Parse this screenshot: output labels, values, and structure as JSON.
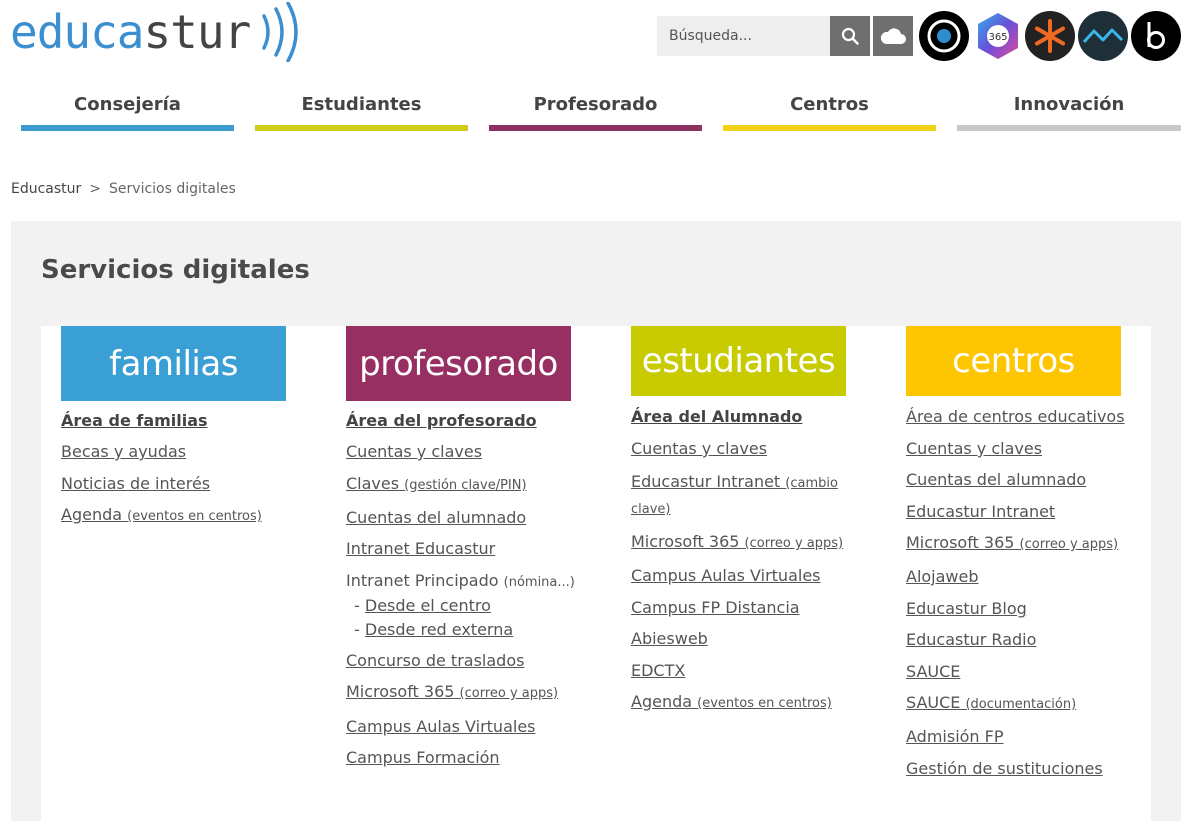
{
  "header": {
    "logo": {
      "part1": "educa",
      "part2": "stur"
    },
    "search": {
      "placeholder": "Búsqueda..."
    },
    "colors": {
      "logo_blue": "#3b8fd0",
      "button_gray": "#6f6f6f"
    }
  },
  "nav": [
    {
      "label": "Consejería",
      "color": "#3b9ccd"
    },
    {
      "label": "Estudiantes",
      "color": "#cfcd1a"
    },
    {
      "label": "Profesorado",
      "color": "#8e3160"
    },
    {
      "label": "Centros",
      "color": "#f2d218"
    },
    {
      "label": "Innovación",
      "color": "#c8c8c8"
    }
  ],
  "breadcrumb": {
    "home": "Educastur",
    "sep": ">",
    "current": "Servicios digitales"
  },
  "page": {
    "title": "Servicios digitales"
  },
  "columns": {
    "familias": {
      "banner": "familias",
      "color": "#3a9fd4",
      "links": {
        "l0": "Área de familias",
        "l1": "Becas y ayudas",
        "l2": "Noticias de interés",
        "l3": "Agenda",
        "l3s": "(eventos en centros)"
      }
    },
    "profesorado": {
      "banner": "profesorado",
      "color": "#982f63",
      "links": {
        "l0": "Área del profesorado",
        "l1": "Cuentas y claves",
        "l2": "Claves",
        "l2s": "(gestión clave/PIN)",
        "l3": "Cuentas del alumnado",
        "l4": "Intranet Educastur",
        "l5": "Intranet Principado",
        "l5s": "(nómina...)",
        "l5a_dash": "-",
        "l5a": "Desde el centro",
        "l5b_dash": "-",
        "l5b": "Desde red externa",
        "l6": "Concurso de traslados",
        "l7": "Microsoft 365",
        "l7s": "(correo y apps)",
        "l8": "Campus Aulas Virtuales",
        "l9": "Campus Formación"
      }
    },
    "estudiantes": {
      "banner": "estudiantes",
      "color": "#c8cb00",
      "links": {
        "l0": "Área del Alumnado",
        "l1": "Cuentas y claves",
        "l2": "Educastur Intranet",
        "l2s": "(cambio clave)",
        "l3": "Microsoft 365",
        "l3s": "(correo y apps)",
        "l4": "Campus Aulas Virtuales",
        "l5": "Campus FP Distancia",
        "l6": "Abiesweb",
        "l7": "EDCTX",
        "l8": "Agenda",
        "l8s": "(eventos en centros)"
      }
    },
    "centros": {
      "banner": "centros",
      "color": "#fdc600",
      "links": {
        "l0": "Área de centros educativos",
        "l1": "Cuentas y claves",
        "l2": "Cuentas del alumnado",
        "l3": "Educastur Intranet",
        "l4": "Microsoft 365",
        "l4s": "(correo y apps)",
        "l5": "Alojaweb",
        "l6": "Educastur Blog",
        "l7": "Educastur Radio",
        "l8": "SAUCE",
        "l9": "SAUCE",
        "l9s": "(documentación)",
        "l10": "Admisión FP",
        "l11": "Gestión de sustituciones"
      }
    }
  }
}
